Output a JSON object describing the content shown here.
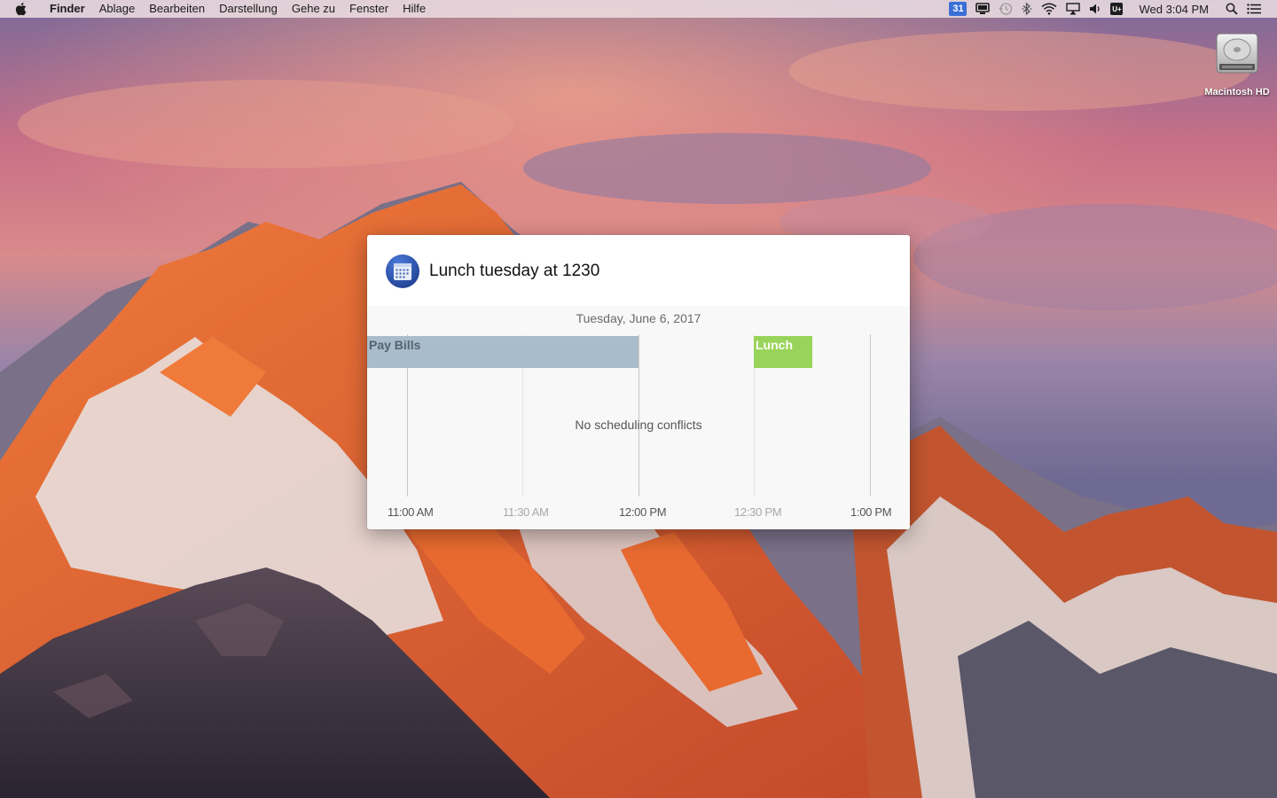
{
  "menubar": {
    "app_name": "Finder",
    "menus": [
      "Ablage",
      "Bearbeiten",
      "Darstellung",
      "Gehe zu",
      "Fenster",
      "Hilfe"
    ],
    "calendar_badge": "31",
    "uplus_label": "U+",
    "clock": "Wed 3:04 PM",
    "status_icons": [
      "calendar-icon",
      "display-icon",
      "time-machine-icon",
      "bluetooth-icon",
      "wifi-icon",
      "airplay-icon",
      "volume-icon",
      "uplus-icon",
      "spotlight-icon",
      "notification-center-icon"
    ]
  },
  "desktop": {
    "disk_label": "Macintosh HD"
  },
  "popup": {
    "query": "Lunch tuesday at 1230",
    "date": "Tuesday, June 6, 2017",
    "status": "No scheduling conflicts",
    "events": [
      {
        "title": "Pay Bills",
        "color": "#a9bccb"
      },
      {
        "title": "Lunch",
        "color": "#99d45a"
      }
    ],
    "time_labels": [
      "11:00 AM",
      "11:30 AM",
      "12:00 PM",
      "12:30 PM",
      "1:00 PM"
    ],
    "accent": "#2a4fa8"
  }
}
